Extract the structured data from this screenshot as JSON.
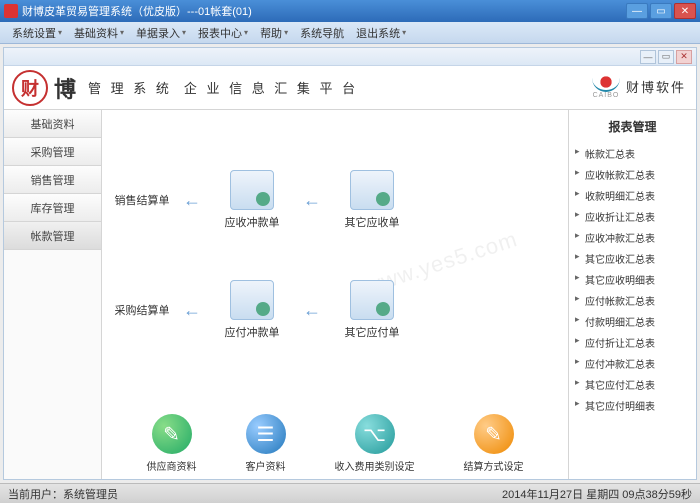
{
  "window": {
    "title": "财博皮革贸易管理系统（优皮版）---01帐套(01)"
  },
  "menu": {
    "items": [
      "系统设置",
      "基础资料",
      "单据录入",
      "报表中心",
      "帮助",
      "系统导航",
      "退出系统"
    ]
  },
  "brand": {
    "logo_char": "财",
    "name": "博",
    "line1": "管 理 系 统",
    "line2": "企 业 信 息 汇 集 平 台",
    "right_sub": "CAIBO",
    "right_text": "财博软件"
  },
  "sidebar": {
    "items": [
      {
        "label": "基础资料"
      },
      {
        "label": "采购管理"
      },
      {
        "label": "销售管理"
      },
      {
        "label": "库存管理"
      },
      {
        "label": "帐款管理"
      }
    ]
  },
  "flows": {
    "row1": {
      "label": "销售结算单",
      "item1": "应收冲款单",
      "item2": "其它应收单"
    },
    "row2": {
      "label": "采购结算单",
      "item1": "应付冲款单",
      "item2": "其它应付单"
    }
  },
  "bottom": {
    "items": [
      {
        "label": "供应商资料"
      },
      {
        "label": "客户资料"
      },
      {
        "label": "收入费用类别设定"
      },
      {
        "label": "结算方式设定"
      }
    ]
  },
  "right_panel": {
    "title": "报表管理",
    "items": [
      "帐款汇总表",
      "应收帐款汇总表",
      "收款明细汇总表",
      "应收折让汇总表",
      "应收冲款汇总表",
      "其它应收汇总表",
      "其它应收明细表",
      "应付帐款汇总表",
      "付款明细汇总表",
      "应付折让汇总表",
      "应付冲款汇总表",
      "其它应付汇总表",
      "其它应付明细表"
    ]
  },
  "statusbar": {
    "user_label": "当前用户：",
    "user_value": "系统管理员",
    "datetime": "2014年11月27日  星期四  09点38分59秒"
  },
  "watermark": "www.yes5.com"
}
